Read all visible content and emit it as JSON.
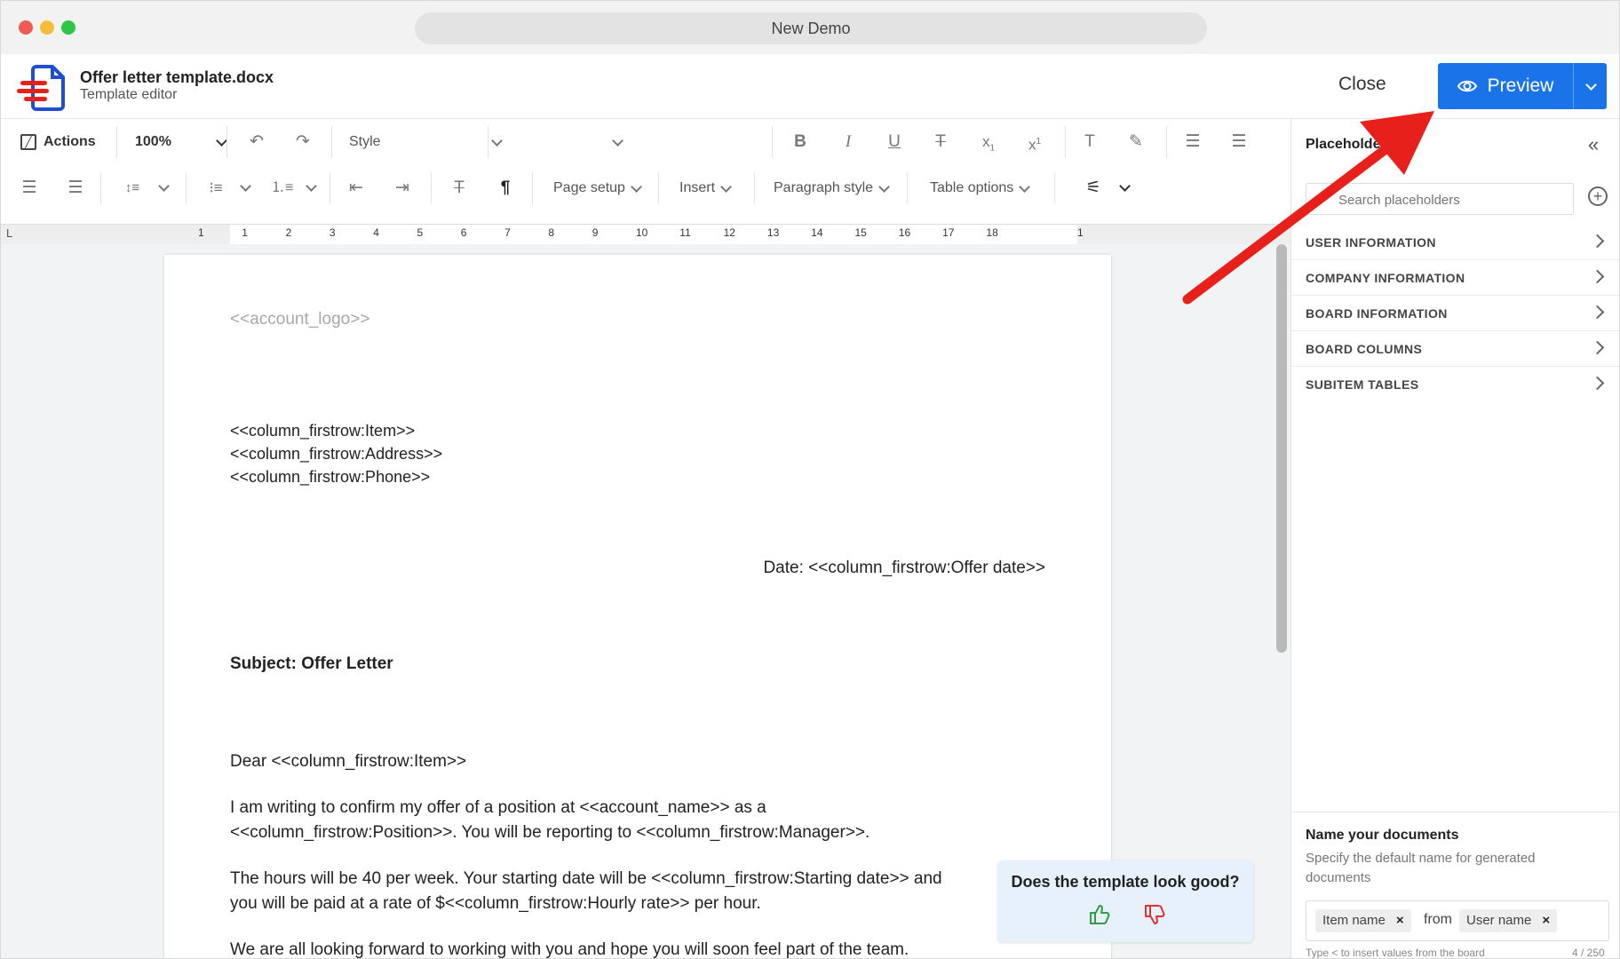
{
  "window": {
    "title": "New Demo"
  },
  "header": {
    "doc_title": "Offer letter template.docx",
    "doc_subtitle": "Template editor",
    "close_label": "Close",
    "preview_label": "Preview"
  },
  "toolbar": {
    "actions_label": "Actions",
    "zoom": "100%",
    "style_label": "Style",
    "page_setup": "Page setup",
    "insert": "Insert",
    "paragraph_style": "Paragraph style",
    "table_options": "Table options"
  },
  "ruler": {
    "corner": "L",
    "numbers": [
      "1",
      "1",
      "2",
      "3",
      "4",
      "5",
      "6",
      "7",
      "8",
      "9",
      "10",
      "11",
      "12",
      "13",
      "14",
      "15",
      "16",
      "17",
      "18",
      "1"
    ]
  },
  "document": {
    "logo_placeholder": "<<account_logo>>",
    "address_lines": [
      "<<column_firstrow:Item>>",
      "<<column_firstrow:Address>>",
      "<<column_firstrow:Phone>>"
    ],
    "date_line": "Date: <<column_firstrow:Offer date>>",
    "subject": "Subject: Offer Letter",
    "greeting": "Dear <<column_firstrow:Item>>",
    "para1_line1": "I am writing to confirm my offer of a position at <<account_name>> as a",
    "para1_line2": "<<column_firstrow:Position>>. You will be reporting to <<column_firstrow:Manager>>.",
    "para2_line1": "The hours will be 40 per week. Your starting date will be <<column_firstrow:Starting date>> and",
    "para2_line2": "you will be paid at a rate of $<<column_firstrow:Hourly rate>> per hour.",
    "para3_line1": "We are all looking forward to working with you and hope you will soon feel part of the team."
  },
  "feedback": {
    "question": "Does the template look good?"
  },
  "panel": {
    "title": "Placeholders",
    "search_placeholder": "Search placeholders",
    "categories": [
      "USER INFORMATION",
      "COMPANY INFORMATION",
      "BOARD INFORMATION",
      "BOARD COLUMNS",
      "SUBITEM TABLES"
    ],
    "name_title": "Name your documents",
    "name_desc": "Specify the default name for generated documents",
    "chip1": "Item name",
    "from": "from",
    "chip2": "User name",
    "hint": "Type < to insert values from the board",
    "count": "4 / 250"
  },
  "colors": {
    "accent": "#1a73e8",
    "arrow": "#e8201b"
  }
}
